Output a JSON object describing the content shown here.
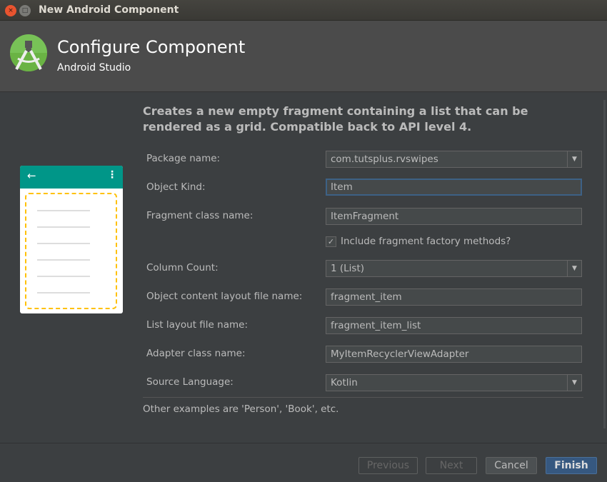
{
  "window": {
    "title": "New Android Component",
    "close_icon": "×",
    "min_icon": "□"
  },
  "header": {
    "title": "Configure Component",
    "subtitle": "Android Studio"
  },
  "description": "Creates a new empty fragment containing a list that can be rendered as a grid. Compatible back to API level 4.",
  "form": {
    "package_name": {
      "label": "Package name:",
      "value": "com.tutsplus.rvswipes"
    },
    "object_kind": {
      "label": "Object Kind:",
      "value": "Item"
    },
    "fragment_class": {
      "label": "Fragment class name:",
      "value": "ItemFragment"
    },
    "factory_methods": {
      "label": "Include fragment factory methods?",
      "checked": true
    },
    "column_count": {
      "label": "Column Count:",
      "value": "1 (List)"
    },
    "content_layout": {
      "label": "Object content layout file name:",
      "value": "fragment_item"
    },
    "list_layout": {
      "label": "List layout file name:",
      "value": "fragment_item_list"
    },
    "adapter_class": {
      "label": "Adapter class name:",
      "value": "MyItemRecyclerViewAdapter"
    },
    "source_language": {
      "label": "Source Language:",
      "value": "Kotlin"
    }
  },
  "hint": "Other examples are 'Person', 'Book', etc.",
  "buttons": {
    "previous": "Previous",
    "next": "Next",
    "cancel": "Cancel",
    "finish": "Finish"
  },
  "colors": {
    "accent": "#365880",
    "preview_toolbar": "#009688",
    "preview_dash": "#ffc107"
  }
}
